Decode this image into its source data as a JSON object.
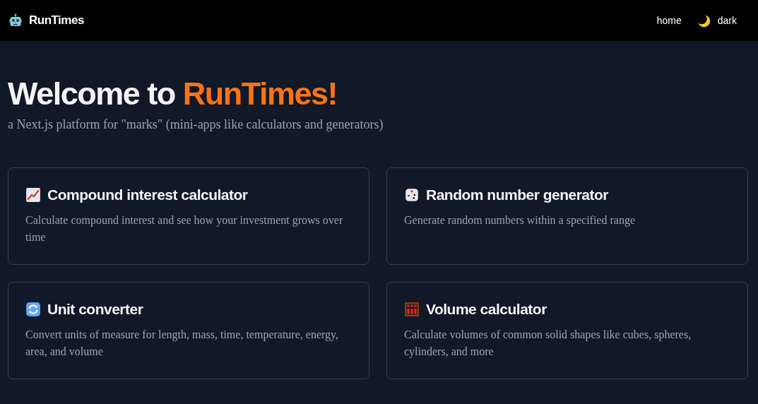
{
  "navbar": {
    "brand": "RunTimes",
    "links": [
      {
        "label": "home"
      },
      {
        "label": "dark"
      }
    ]
  },
  "hero": {
    "title_prefix": "Welcome to ",
    "title_highlight": "RunTimes!",
    "subtitle": "a Next.js platform for \"marks\" (mini-apps like calculators and generators)"
  },
  "cards": [
    {
      "title": "Compound interest calculator",
      "description": "Calculate compound interest and see how your investment grows over time"
    },
    {
      "title": "Random number generator",
      "description": "Generate random numbers within a specified range"
    },
    {
      "title": "Unit converter",
      "description": "Convert units of measure for length, mass, time, temperature, energy, area, and volume"
    },
    {
      "title": "Volume calculator",
      "description": "Calculate volumes of common solid shapes like cubes, spheres, cylinders, and more"
    }
  ]
}
